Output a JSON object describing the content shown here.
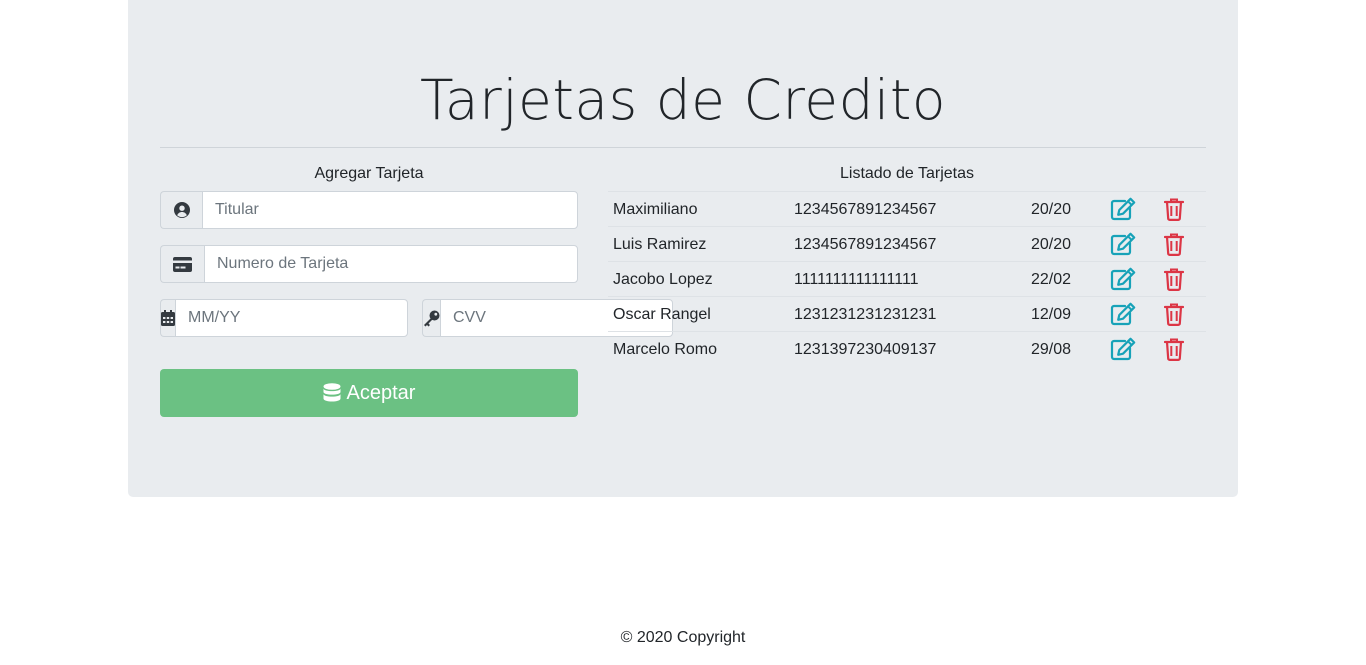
{
  "page": {
    "title": "Tarjetas de Credito"
  },
  "form": {
    "heading": "Agregar Tarjeta",
    "titular_placeholder": "Titular",
    "numero_placeholder": "Numero de Tarjeta",
    "fecha_placeholder": "MM/YY",
    "cvv_placeholder": "CVV",
    "submit_label": "Aceptar",
    "submit_color": "#6bc183"
  },
  "list": {
    "heading": "Listado de Tarjetas",
    "rows": [
      {
        "titular": "Maximiliano",
        "numero": "1234567891234567",
        "fecha": "20/20"
      },
      {
        "titular": "Luis Ramirez",
        "numero": "1234567891234567",
        "fecha": "20/20"
      },
      {
        "titular": "Jacobo Lopez",
        "numero": "1111111111111111",
        "fecha": "22/02"
      },
      {
        "titular": "Oscar Rangel",
        "numero": "1231231231231231",
        "fecha": "12/09"
      },
      {
        "titular": "Marcelo Romo",
        "numero": "1231397230409137",
        "fecha": "29/08"
      }
    ],
    "edit_icon": "edit-icon",
    "delete_icon": "trash-icon",
    "edit_color": "#17a2b8",
    "delete_color": "#dc3545"
  },
  "footer": {
    "text": "© 2020 Copyright"
  }
}
